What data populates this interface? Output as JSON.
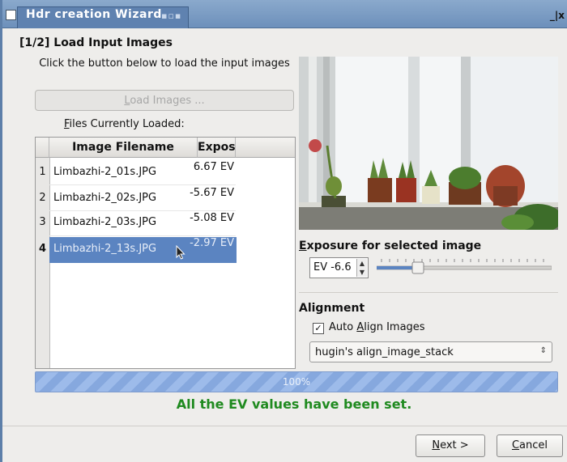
{
  "window": {
    "title": "Hdr creation Wizard",
    "controls": "_|x"
  },
  "step": {
    "heading": "[1/2] Load Input Images",
    "instruction": "Click the button below to load the input images"
  },
  "load_button": {
    "label_first": "L",
    "label_rest": "oad Images ..."
  },
  "files_label": {
    "first": "F",
    "rest": "iles Currently Loaded:"
  },
  "table": {
    "columns": [
      "Image Filename",
      "Exposure"
    ],
    "rows": [
      {
        "num": "1",
        "filename": "Limbazhi-2_01s.JPG",
        "exposure": "6.67 EV"
      },
      {
        "num": "2",
        "filename": "Limbazhi-2_02s.JPG",
        "exposure": "-5.67 EV"
      },
      {
        "num": "3",
        "filename": "Limbazhi-2_03s.JPG",
        "exposure": "-5.08 EV"
      },
      {
        "num": "4",
        "filename": "Limbazhi-2_13s.JPG",
        "exposure": "-2.97 EV"
      }
    ],
    "selected_index": 3
  },
  "exposure": {
    "label_first": "E",
    "label_rest": "xposure for selected image",
    "spin_value": "EV -6.6",
    "slider_level": 0.22
  },
  "alignment": {
    "label": "Alignment",
    "auto_align_first": "A",
    "auto_align_prefix": "Auto ",
    "auto_align_rest": "lign Images",
    "auto_align_checked": true,
    "method": "hugin's align_image_stack"
  },
  "progress": {
    "percent": 100,
    "label": "100%"
  },
  "status_message": "All the EV values have been set.",
  "buttons": {
    "next_first": "N",
    "next_rest": "ext >",
    "cancel_first": "C",
    "cancel_rest": "ancel"
  },
  "colors": {
    "title_bar": "#6d90bb",
    "selection": "#5b84c1",
    "status_text": "#1f8a1f",
    "progress": "#86a8de"
  }
}
